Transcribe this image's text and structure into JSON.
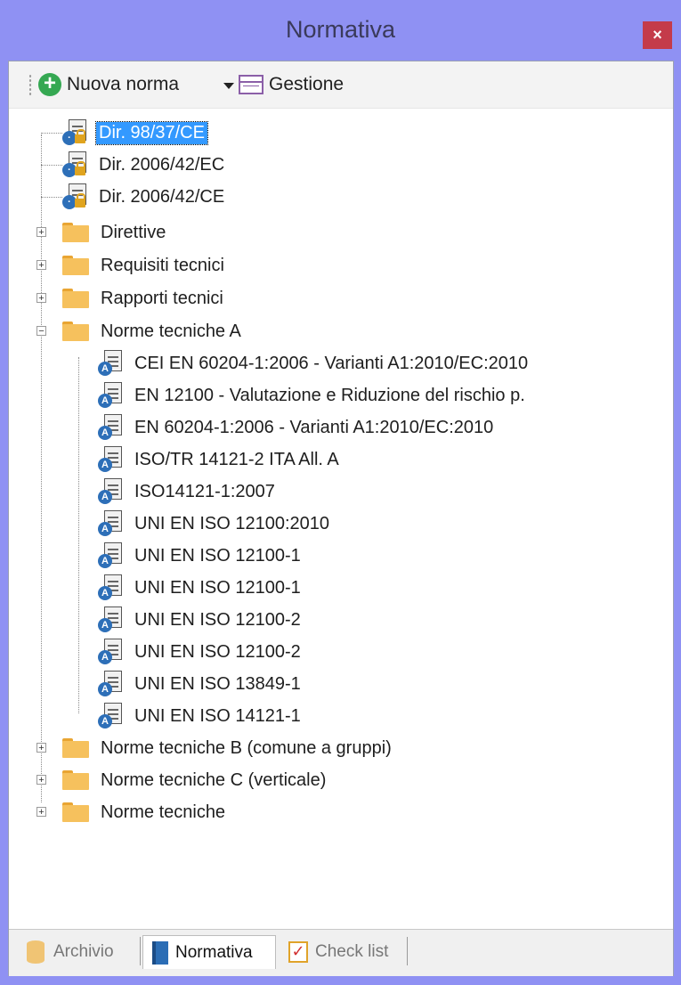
{
  "window": {
    "title": "Normativa",
    "close_symbol": "×"
  },
  "toolbar": {
    "new_label": "Nuova norma",
    "manage_label": "Gestione"
  },
  "tree": {
    "root_docs": [
      "Dir. 98/37/CE",
      "Dir. 2006/42/EC",
      "Dir. 2006/42/CE"
    ],
    "folders": {
      "direttive": "Direttive",
      "requisiti": "Requisiti tecnici",
      "rapporti": "Rapporti tecnici",
      "norme_a": "Norme tecniche A",
      "norme_b": "Norme tecniche B (comune a gruppi)",
      "norme_c": "Norme tecniche C (verticale)",
      "norme": "Norme tecniche"
    },
    "norme_a_items": [
      "CEI EN 60204-1:2006 - Varianti A1:2010/EC:2010",
      "EN 12100 - Valutazione e Riduzione del rischio p.",
      "EN 60204-1:2006 - Varianti A1:2010/EC:2010",
      "ISO/TR 14121-2 ITA All. A",
      "ISO14121-1:2007",
      "UNI EN ISO 12100:2010",
      "UNI EN ISO 12100-1",
      "UNI EN ISO 12100-1",
      "UNI EN ISO 12100-2",
      "UNI EN ISO 12100-2",
      "UNI EN ISO 13849-1",
      "UNI EN ISO 14121-1"
    ],
    "selected": "Dir. 98/37/CE"
  },
  "tabs": {
    "archivio": "Archivio",
    "normativa": "Normativa",
    "checklist": "Check list",
    "active": "Normativa"
  },
  "colors": {
    "titlebar": "#8f91f3",
    "close": "#c43b4a",
    "selection": "#3399ff",
    "folder": "#f6c15d"
  }
}
